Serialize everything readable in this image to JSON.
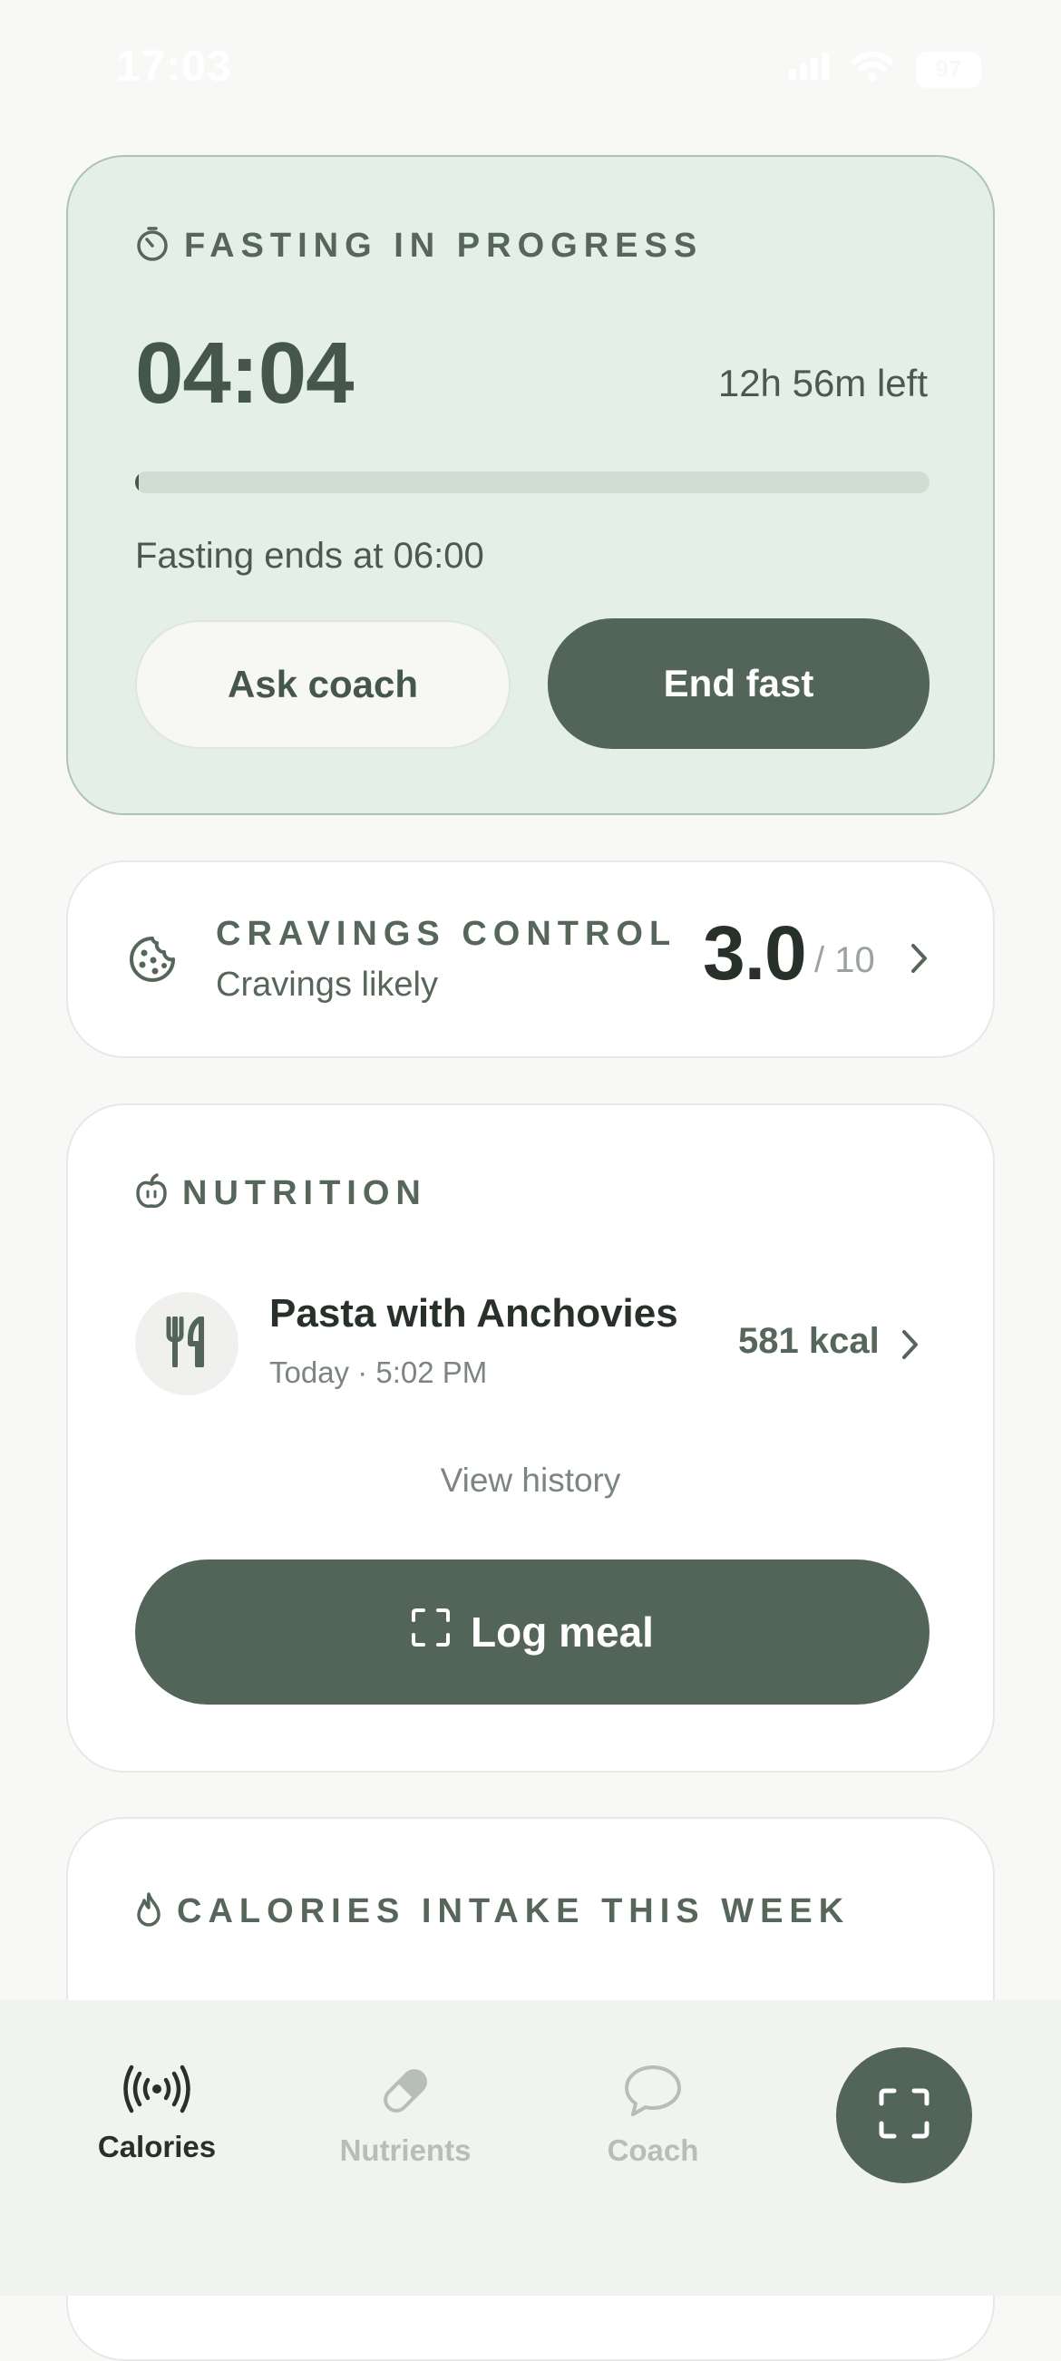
{
  "status_bar": {
    "time": "17:03",
    "battery": "97"
  },
  "fasting": {
    "title": "FASTING IN PROGRESS",
    "elapsed": "04:04",
    "remaining": "12h 56m left",
    "progress_fraction": 0.005,
    "ends_text": "Fasting ends at 06:00",
    "ask_coach_label": "Ask coach",
    "end_fast_label": "End fast"
  },
  "cravings": {
    "title": "CRAVINGS CONTROL",
    "subtitle": "Cravings likely",
    "score": "3.0",
    "max": "/ 10"
  },
  "nutrition": {
    "title": "NUTRITION",
    "meal": {
      "name": "Pasta with Anchovies",
      "time": "Today · 5:02 PM",
      "kcal": "581 kcal"
    },
    "view_history_label": "View history",
    "log_meal_label": "Log meal"
  },
  "calories_week": {
    "title": "CALORIES INTAKE THIS WEEK"
  },
  "tab_bar": {
    "tabs": [
      {
        "label": "Calories",
        "icon": "broadcast-icon",
        "active": true
      },
      {
        "label": "Nutrients",
        "icon": "pill-icon",
        "active": false
      },
      {
        "label": "Coach",
        "icon": "chat-bubble-icon",
        "active": false
      }
    ],
    "scan_icon": "scan-frame-icon"
  },
  "colors": {
    "accent": "#526558",
    "fasting_bg": "#e4f0e7",
    "page_bg": "#f8f8f7"
  }
}
